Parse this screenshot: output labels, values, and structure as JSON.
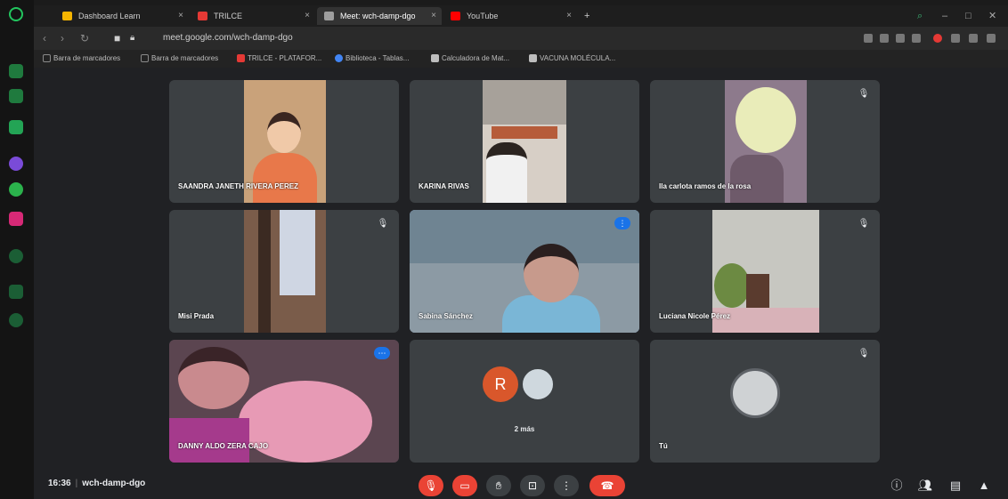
{
  "browser": {
    "tabs": [
      {
        "label": "Dashboard Learn",
        "fav_color": "#f5b400"
      },
      {
        "label": "TRILCE",
        "fav_color": "#e53935"
      },
      {
        "label": "Meet: wch-damp-dgo",
        "fav_color": "#9e9e9e"
      },
      {
        "label": "YouTube",
        "fav_color": "#ff0000"
      }
    ],
    "new_tab": "+",
    "url": "meet.google.com/wch-damp-dgo",
    "bookmarks": [
      {
        "label": "Barra de marcadores",
        "color": "#8a8a8a"
      },
      {
        "label": "Barra de marcadores",
        "color": "#8a8a8a"
      },
      {
        "label": "TRILCE - PLATAFOR...",
        "color": "#e53935"
      },
      {
        "label": "Biblioteca - Tablas...",
        "color": "#4285f4"
      },
      {
        "label": "Calculadora de Mat...",
        "color": "#bdbdbd"
      },
      {
        "label": "VACUNA MOLÉCULA...",
        "color": "#bdbdbd"
      }
    ]
  },
  "participants": [
    {
      "name": "SAANDRA JANETH RIVERA PEREZ",
      "bg": "#c9a27a",
      "accent": "#e8784a"
    },
    {
      "name": "KARINA RIVAS",
      "bg": "#b99a7c",
      "accent": "#f1f1f1"
    },
    {
      "name": "Ila carlota ramos de la rosa",
      "bg": "#8d7a8c",
      "accent": "#e9ecb9"
    },
    {
      "name": "Misi Prada",
      "bg": "#7a5c4a",
      "accent": "#cfd6e3"
    },
    {
      "name": "Sabina Sánchez",
      "bg": "#6f8492",
      "accent": "#c79a8c"
    },
    {
      "name": "Luciana Nicole Pérez",
      "bg": "#c7c7c1",
      "accent": "#6c8a42"
    },
    {
      "name": "DANNY ALDO ZERA CAJO",
      "bg": "#5b4550",
      "accent": "#e79ab5"
    },
    {
      "name": "2 más",
      "avatar_letter": "R",
      "avatar_color": "#d9572b"
    },
    {
      "name": "Tú",
      "avatar_color": "#cfd2d4"
    }
  ],
  "controls": {
    "time": "16:36",
    "meeting_code": "wch-damp-dgo"
  },
  "colors": {
    "meet_bg": "#202124",
    "tile_bg": "#3c4043",
    "danger": "#ea4335",
    "speaking": "#8ab4f8"
  }
}
